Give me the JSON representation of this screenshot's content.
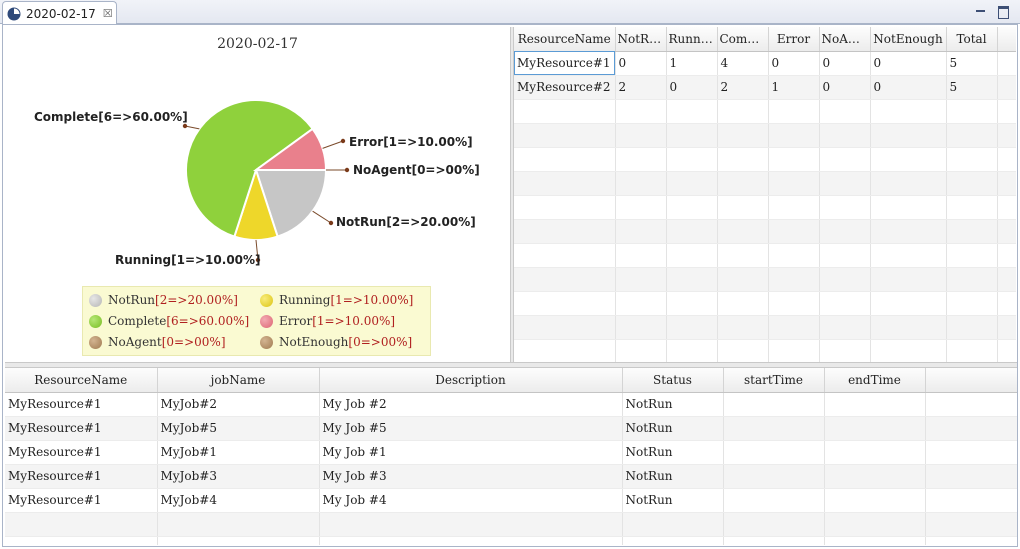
{
  "tab": {
    "title": "2020-02-17",
    "close_glyph": "☒"
  },
  "chart_data": {
    "type": "pie",
    "title": "2020-02-17",
    "slices": [
      {
        "name": "NotRun",
        "label": "NotRun[2=>20.00%]",
        "count": 2,
        "percent": 20.0,
        "color": "#c6c6c6"
      },
      {
        "name": "Running",
        "label": "Running[1=>10.00%]",
        "count": 1,
        "percent": 10.0,
        "color": "#eed72a"
      },
      {
        "name": "Complete",
        "label": "Complete[6=>60.00%]",
        "count": 6,
        "percent": 60.0,
        "color": "#8fd13c"
      },
      {
        "name": "Error",
        "label": "Error[1=>10.00%]",
        "count": 1,
        "percent": 10.0,
        "color": "#e9808c"
      },
      {
        "name": "NoAgent",
        "label": "NoAgent[0=>00%]",
        "count": 0,
        "percent": 0,
        "color": "#b59066"
      },
      {
        "name": "NotEnough",
        "label": "NotEnough[0=>00%]",
        "count": 0,
        "percent": 0,
        "color": "#b59066"
      }
    ],
    "legend": [
      {
        "name": "NotRun",
        "value": "[2=>20.00%]",
        "color": "#c6c6c6"
      },
      {
        "name": "Running",
        "value": "[1=>10.00%]",
        "color": "#eed72a"
      },
      {
        "name": "Complete",
        "value": "[6=>60.00%]",
        "color": "#8fd13c"
      },
      {
        "name": "Error",
        "value": "[1=>10.00%]",
        "color": "#e9808c"
      },
      {
        "name": "NoAgent",
        "value": "[0=>00%]",
        "color": "#b59066"
      },
      {
        "name": "NotEnough",
        "value": "[0=>00%]",
        "color": "#b59066"
      }
    ]
  },
  "resource_grid": {
    "columns": [
      "ResourceName",
      "NotRun",
      "Running",
      "Compl...",
      "Error",
      "NoAgent",
      "NotEnough",
      "Total"
    ],
    "rows": [
      [
        "MyResource#1",
        "0",
        "1",
        "4",
        "0",
        "0",
        "0",
        "5"
      ],
      [
        "MyResource#2",
        "2",
        "0",
        "2",
        "1",
        "0",
        "0",
        "5"
      ]
    ]
  },
  "job_grid": {
    "columns": [
      "ResourceName",
      "jobName",
      "Description",
      "Status",
      "startTime",
      "endTime"
    ],
    "rows": [
      [
        "MyResource#1",
        "MyJob#2",
        "My Job #2",
        "NotRun",
        "",
        ""
      ],
      [
        "MyResource#1",
        "MyJob#5",
        "My Job #5",
        "NotRun",
        "",
        ""
      ],
      [
        "MyResource#1",
        "MyJob#1",
        "My Job #1",
        "NotRun",
        "",
        ""
      ],
      [
        "MyResource#1",
        "MyJob#3",
        "My Job #3",
        "NotRun",
        "",
        ""
      ],
      [
        "MyResource#1",
        "MyJob#4",
        "My Job #4",
        "NotRun",
        "",
        ""
      ]
    ]
  }
}
